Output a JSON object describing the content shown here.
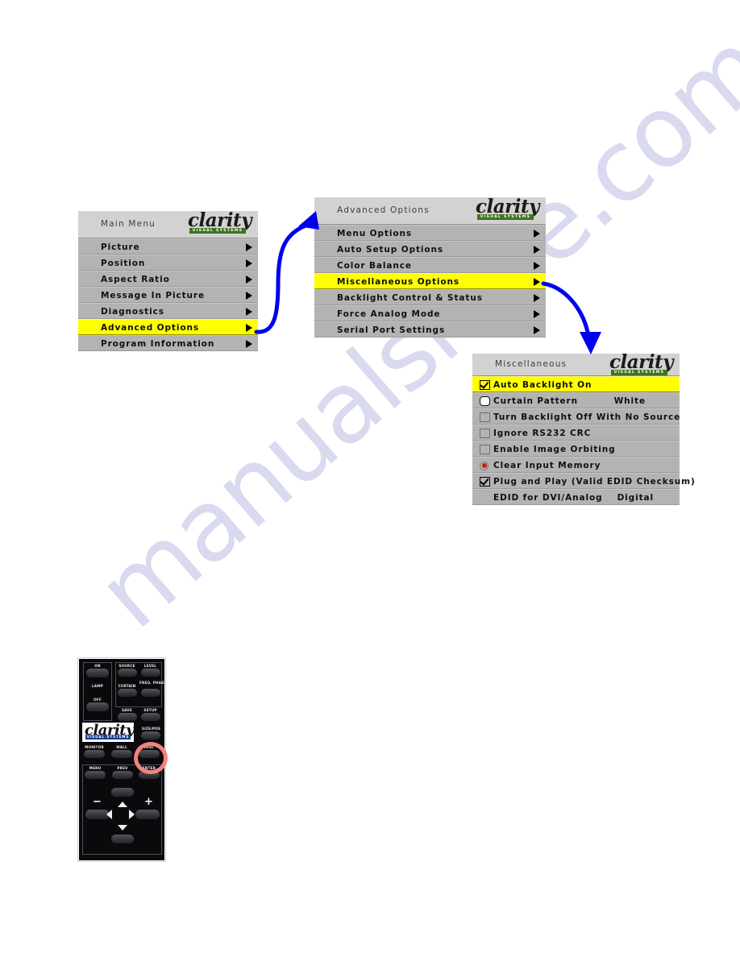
{
  "watermark": {
    "text": "manualshive.com"
  },
  "brand": {
    "name": "clarity",
    "tagline": "VISUAL SYSTEMS"
  },
  "menus": {
    "main": {
      "title": "Main Menu",
      "rows": [
        {
          "label": "Picture",
          "selected": false
        },
        {
          "label": "Position",
          "selected": false
        },
        {
          "label": "Aspect Ratio",
          "selected": false
        },
        {
          "label": "Message In Picture",
          "selected": false
        },
        {
          "label": "Diagnostics",
          "selected": false
        },
        {
          "label": "Advanced Options",
          "selected": true
        },
        {
          "label": "Program Information",
          "selected": false
        }
      ]
    },
    "advanced": {
      "title": "Advanced Options",
      "rows": [
        {
          "label": "Menu Options",
          "selected": false
        },
        {
          "label": "Auto Setup Options",
          "selected": false
        },
        {
          "label": "Color Balance",
          "selected": false
        },
        {
          "label": "Miscellaneous Options",
          "selected": true
        },
        {
          "label": "Backlight Control & Status",
          "selected": false
        },
        {
          "label": "Force Analog Mode",
          "selected": false
        },
        {
          "label": "Serial Port Settings",
          "selected": false
        }
      ]
    },
    "miscellaneous": {
      "title": "Miscellaneous",
      "rows": [
        {
          "label": "Auto Backlight On",
          "control": "checkbox-checked",
          "value": "",
          "selected": true
        },
        {
          "label": "Curtain Pattern",
          "control": "rounded-box",
          "value": "White",
          "selected": false
        },
        {
          "label": "Turn Backlight Off With No Source",
          "control": "checkbox-empty",
          "value": "",
          "selected": false
        },
        {
          "label": "Ignore RS232 CRC",
          "control": "checkbox-empty",
          "value": "",
          "selected": false
        },
        {
          "label": "Enable Image Orbiting",
          "control": "checkbox-empty",
          "value": "",
          "selected": false
        },
        {
          "label": "Clear Input Memory",
          "control": "radio-red",
          "value": "",
          "selected": false
        },
        {
          "label": "Plug and Play (Valid EDID Checksum)",
          "control": "checkbox-checked",
          "value": "",
          "selected": false
        },
        {
          "label": "EDID for DVI/Analog",
          "control": "none",
          "value": "Digital",
          "selected": false
        }
      ]
    }
  },
  "remote": {
    "buttons": {
      "on": "ON",
      "lamp": "LAMP",
      "off": "OFF",
      "source": "SOURCE",
      "level": "LEVEL",
      "curtain": "CURTAIN",
      "freq_phase": "FREQ. PHASE",
      "save": "SAVE",
      "setup": "SETUP",
      "size_pos": "SIZE/POS",
      "monitor": "MONITOR",
      "wall": "WALL",
      "misc": "MISC",
      "menu": "MENU",
      "prev": "PREV",
      "enter": "ENTER",
      "minus": "−",
      "plus": "+"
    }
  },
  "colors": {
    "highlight": "#ffff00",
    "panel_row": "#b3b3b3",
    "panel_header": "#d2d2d2",
    "arrow_blue": "#0000ee",
    "callout_red": "#f4827e",
    "logo_green": "#3f7322"
  }
}
